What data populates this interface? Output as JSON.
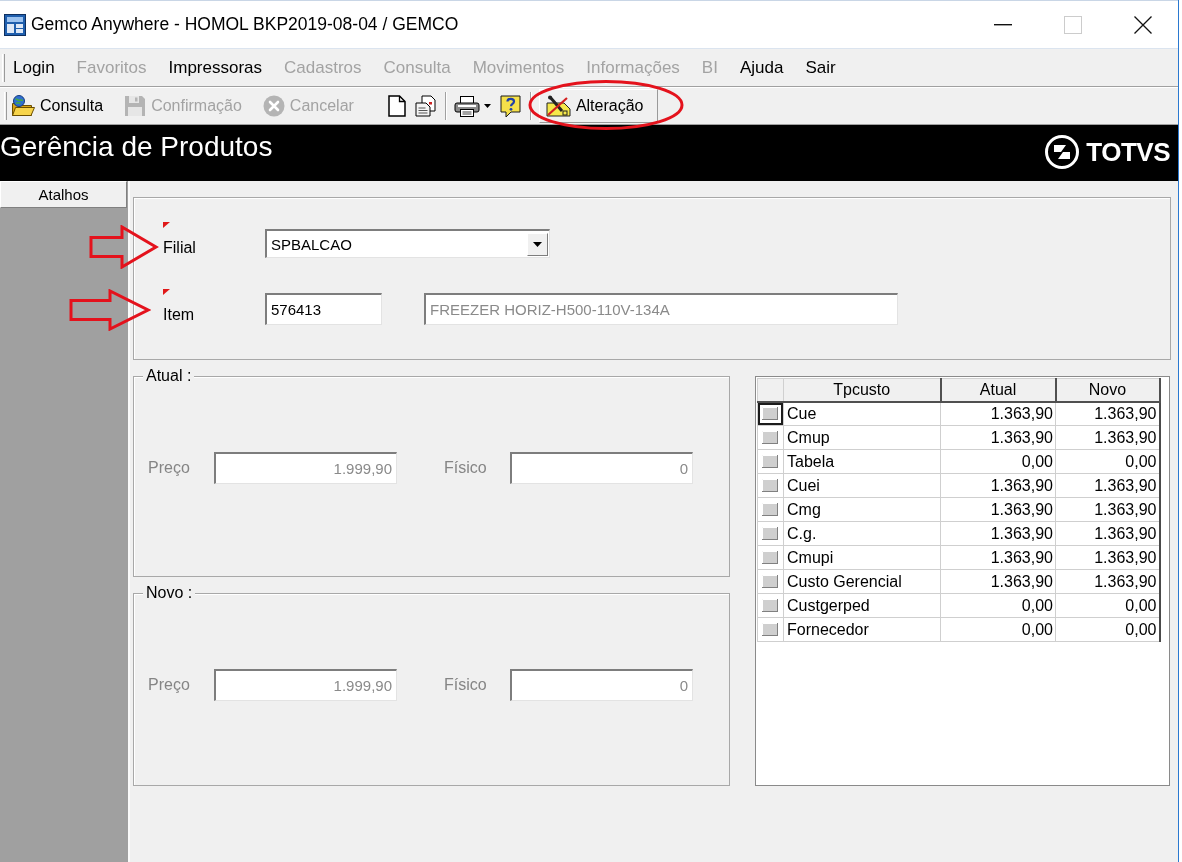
{
  "window": {
    "title": "Gemco Anywhere - HOMOL BKP2019-08-04 / GEMCO",
    "controls": [
      {
        "kind": "minimize",
        "disabled": false
      },
      {
        "kind": "maximize",
        "disabled": true
      },
      {
        "kind": "close",
        "disabled": false
      }
    ]
  },
  "menu": [
    {
      "label": "Login",
      "disabled": false
    },
    {
      "label": "Favoritos",
      "disabled": true
    },
    {
      "label": "Impressoras",
      "disabled": false
    },
    {
      "label": "Cadastros",
      "disabled": true
    },
    {
      "label": "Consulta",
      "disabled": true
    },
    {
      "label": "Movimentos",
      "disabled": true
    },
    {
      "label": "Informações",
      "disabled": true
    },
    {
      "label": "BI",
      "disabled": true
    },
    {
      "label": "Ajuda",
      "disabled": false
    },
    {
      "label": "Sair",
      "disabled": false
    }
  ],
  "toolbar": {
    "buttons": [
      {
        "label": "Consulta",
        "disabled": false
      },
      {
        "label": "Confirmação",
        "disabled": true
      },
      {
        "label": "Cancelar",
        "disabled": true
      }
    ],
    "edit_button": {
      "label": "Alteração",
      "disabled": false
    }
  },
  "header": {
    "title": "Gerência de Produtos",
    "logo": "TOTVS"
  },
  "sidebar": {
    "button": "Atalhos"
  },
  "selection": [
    {
      "kind": "combo",
      "label": "Filial",
      "required": true,
      "value": "SPBALCAO"
    },
    {
      "kind": "text",
      "label": "Item",
      "required": true,
      "value": "576413",
      "description": {
        "value": "FREEZER HORIZ-H500-110V-134A",
        "disabled": true
      }
    }
  ],
  "groups": [
    {
      "legend": "Atual :",
      "fields": [
        {
          "label": "Preço",
          "value": "1.999,90",
          "disabled": true
        },
        {
          "label": "Físico",
          "value": "0",
          "disabled": true
        }
      ]
    },
    {
      "legend": "Novo :",
      "fields": [
        {
          "label": "Preço",
          "value": "1.999,90",
          "disabled": true
        },
        {
          "label": "Físico",
          "value": "0",
          "disabled": true
        }
      ]
    }
  ],
  "cost_table": {
    "columns": [
      "Tpcusto",
      "Atual",
      "Novo"
    ],
    "rows": [
      {
        "selected": true,
        "cells": [
          "Cue",
          "1.363,90",
          "1.363,90"
        ]
      },
      {
        "selected": false,
        "cells": [
          "Cmup",
          "1.363,90",
          "1.363,90"
        ]
      },
      {
        "selected": false,
        "cells": [
          "Tabela",
          "0,00",
          "0,00"
        ]
      },
      {
        "selected": false,
        "cells": [
          "Cuei",
          "1.363,90",
          "1.363,90"
        ]
      },
      {
        "selected": false,
        "cells": [
          "Cmg",
          "1.363,90",
          "1.363,90"
        ]
      },
      {
        "selected": false,
        "cells": [
          "C.g.",
          "1.363,90",
          "1.363,90"
        ]
      },
      {
        "selected": false,
        "cells": [
          "Cmupi",
          "1.363,90",
          "1.363,90"
        ]
      },
      {
        "selected": false,
        "cells": [
          "Custo Gerencial",
          "1.363,90",
          "1.363,90"
        ]
      },
      {
        "selected": false,
        "cells": [
          "Custgerped",
          "0,00",
          "0,00"
        ]
      },
      {
        "selected": false,
        "cells": [
          "Fornecedor",
          "0,00",
          "0,00"
        ]
      }
    ]
  }
}
